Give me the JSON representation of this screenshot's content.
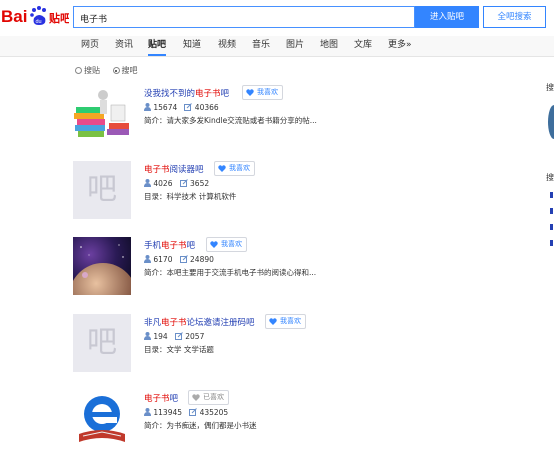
{
  "search": {
    "value": "电子书",
    "enter_label": "进入贴吧",
    "all_label": "全吧搜索"
  },
  "nav": {
    "items": [
      "网页",
      "资讯",
      "贴吧",
      "知道",
      "视频",
      "音乐",
      "图片",
      "地图",
      "文库",
      "更多»"
    ],
    "active": "贴吧"
  },
  "filter": {
    "option1": "搜贴",
    "option2": "搜吧",
    "selected": "搜吧"
  },
  "results": [
    {
      "title_pre": "没我找不到的",
      "title_hl": "电子书",
      "title_post": "吧",
      "like_label": "我喜欢",
      "members": "15674",
      "posts": "40366",
      "desc": "简介：请大家多发Kindle交流贴或者书籍分享的帖...",
      "thumb": "books-illustration"
    },
    {
      "title_pre": "",
      "title_hl": "电子书",
      "title_post": "阅读器吧",
      "like_label": "我喜欢",
      "members": "4026",
      "posts": "3652",
      "desc": "目录：科学技术   计算机软件",
      "thumb": "placeholder",
      "placeholder_char": "吧"
    },
    {
      "title_pre": "手机",
      "title_hl": "电子书",
      "title_post": "吧",
      "like_label": "我喜欢",
      "members": "6170",
      "posts": "24890",
      "desc": "简介：本吧主要用于交流手机电子书的阅读心得和...",
      "thumb": "space-planet"
    },
    {
      "title_pre": "非凡",
      "title_hl": "电子书",
      "title_post": "论坛邀请注册码吧",
      "like_label": "我喜欢",
      "members": "194",
      "posts": "2057",
      "desc": "目录：文学   文学话题",
      "thumb": "placeholder",
      "placeholder_char": "吧"
    },
    {
      "title_pre": "",
      "title_hl": "电子书",
      "title_post": "吧",
      "like_label": "已喜欢",
      "members": "113945",
      "posts": "435205",
      "desc": "简介：为书痴迷，偶们都是小书迷",
      "thumb": "ebook-e-logo"
    }
  ],
  "right_column": {
    "heading1": "搜",
    "heading2": "搜"
  },
  "colors": {
    "brand_blue": "#3385ff",
    "link_blue": "#2440b3",
    "highlight_red": "#e10602",
    "logo_red": "#e10602",
    "logo_blue": "#2932e1"
  }
}
